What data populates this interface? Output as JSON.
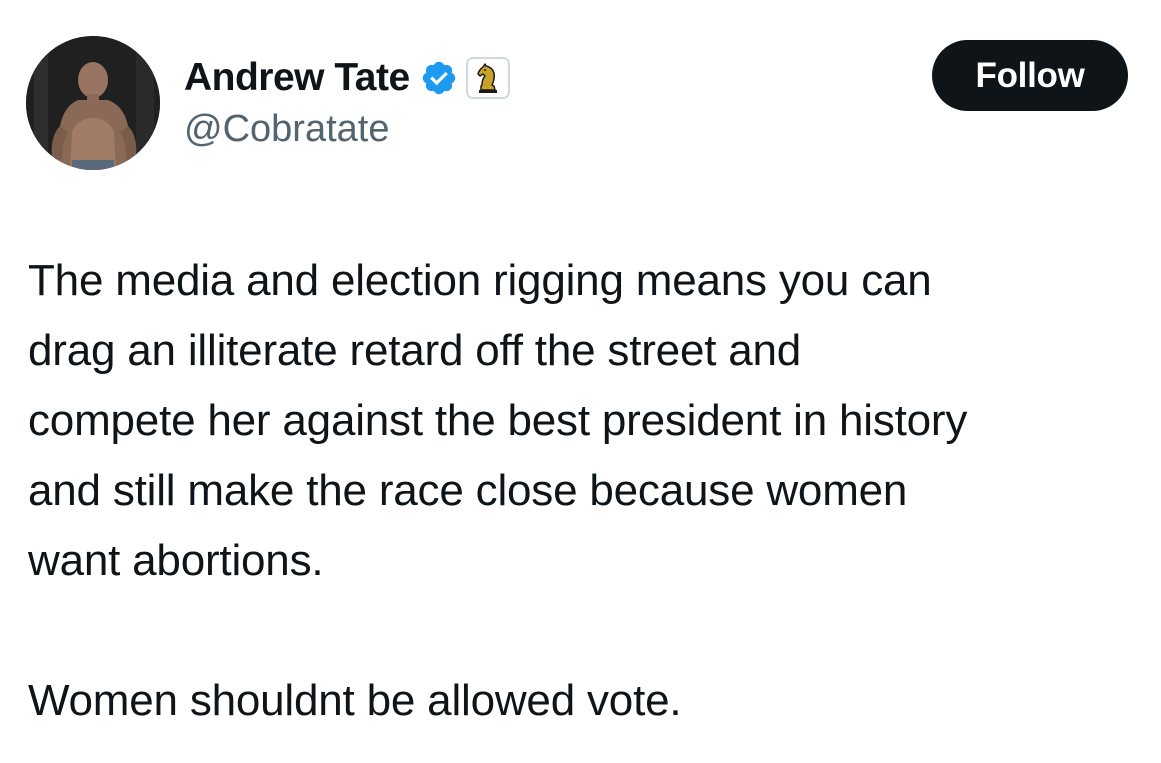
{
  "author": {
    "display_name": "Andrew Tate",
    "handle": "@Cobratate",
    "avatar_icon": "avatar-photo",
    "verified_icon": "verified-checkmark-icon",
    "affiliate_icon": "chess-knight-icon"
  },
  "actions": {
    "follow_label": "Follow"
  },
  "tweet": {
    "lines_para1": [
      "The media and election rigging means you can",
      "drag an illiterate retard off the street and",
      "compete her against the best president in history",
      "and still make the race close because women",
      "want abortions."
    ],
    "para2": "Women shouldnt be allowed vote."
  },
  "colors": {
    "text_primary": "#0f1419",
    "text_secondary": "#536471",
    "verified_blue": "#1d9bf0",
    "follow_bg": "#0f1419",
    "follow_text": "#ffffff",
    "badge_gold": "#c9a227"
  }
}
